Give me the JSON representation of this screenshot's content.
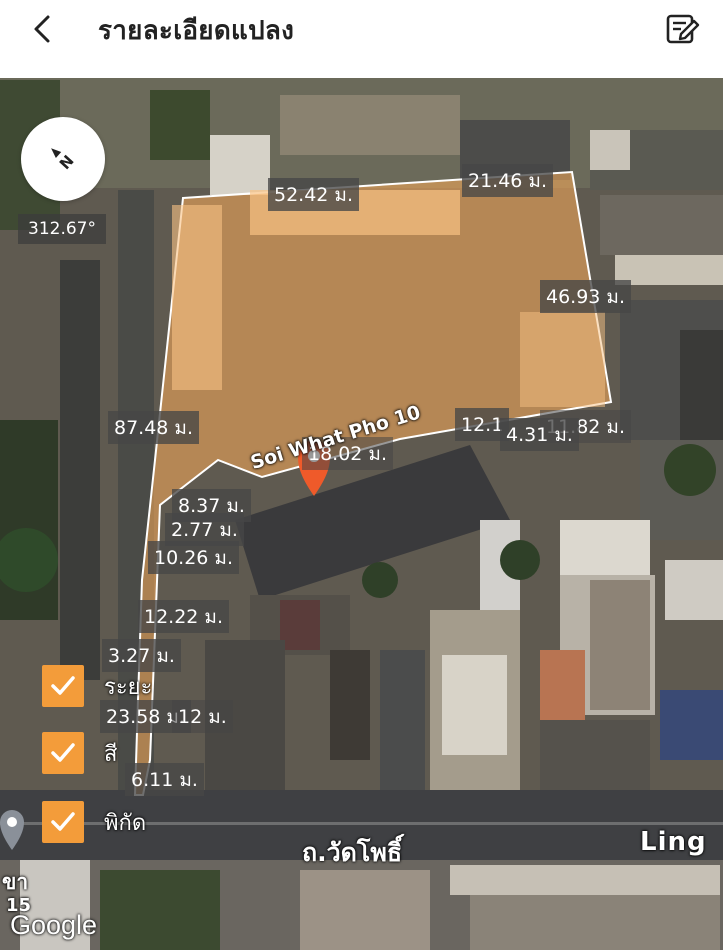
{
  "header": {
    "back_icon": "chevron-left-icon",
    "title": "รายละเอียดแปลง",
    "edit_icon": "edit-note-icon"
  },
  "map": {
    "compass_icon": "compass-north-icon",
    "bearing": "312.67°",
    "road_labels": {
      "soi": "Soi What Pho 10",
      "main_road": "ถ.วัดโพธิ์",
      "ling": "Ling",
      "left_fragment_top": "ขา",
      "left_fragment_bottom": "15"
    },
    "attribution": "Google",
    "parcel_color": "#f3a85a",
    "marker_color": "#ef5a2a"
  },
  "dimensions": [
    "52.42 ม.",
    "21.46 ม.",
    "46.93 ม.",
    "87.48 ม.",
    "12.1",
    "11.82 ม.",
    "4.31 ม.",
    "18.02 ม.",
    "8.37 ม.",
    "2.77 ม.",
    "10.26 ม.",
    "12.22 ม.",
    "3.27 ม.",
    "23.58 ม.",
    "12 ม.",
    "6.11 ม."
  ],
  "toggles": [
    {
      "label": "ระยะ",
      "checked": true
    },
    {
      "label": "สี",
      "checked": true
    },
    {
      "label": "พิกัด",
      "checked": true
    }
  ]
}
